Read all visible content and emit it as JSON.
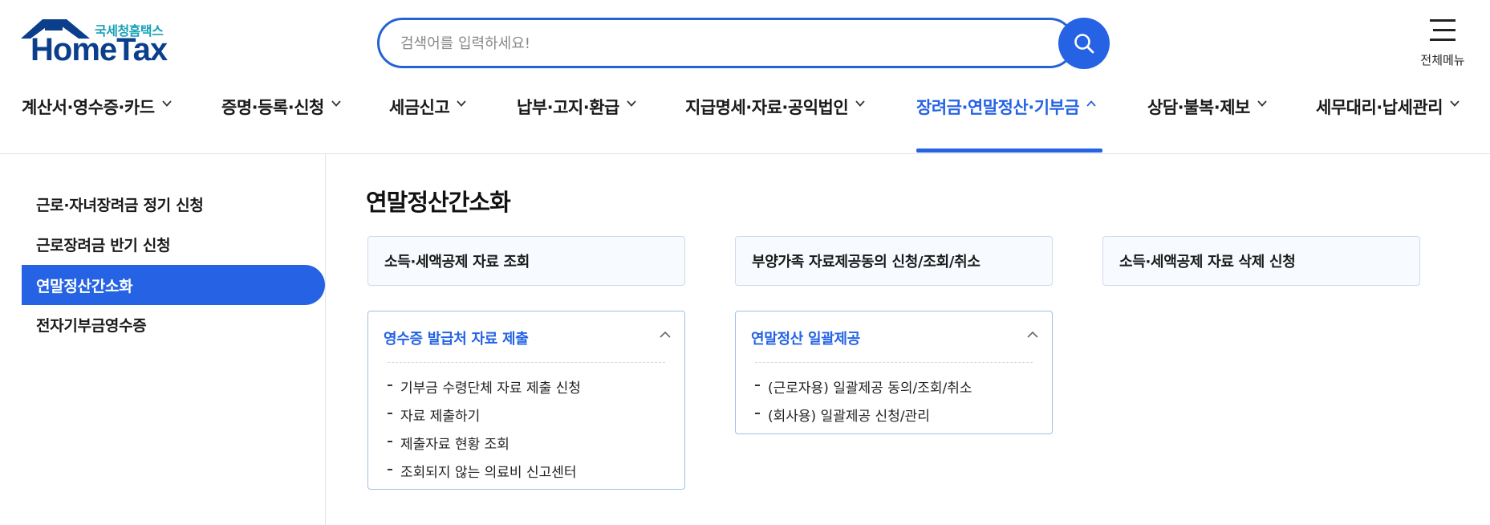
{
  "header": {
    "logo_subtitle": "국세청홈택스",
    "logo_title": "HomeTax",
    "search_placeholder": "검색어를 입력하세요!",
    "menu_label": "전체메뉴"
  },
  "nav": {
    "items": [
      {
        "label": "계산서·영수증·카드",
        "active": false
      },
      {
        "label": "증명·등록·신청",
        "active": false
      },
      {
        "label": "세금신고",
        "active": false
      },
      {
        "label": "납부·고지·환급",
        "active": false
      },
      {
        "label": "지급명세·자료·공익법인",
        "active": false
      },
      {
        "label": "장려금·연말정산·기부금",
        "active": true
      },
      {
        "label": "상담·불복·제보",
        "active": false
      },
      {
        "label": "세무대리·납세관리",
        "active": false
      }
    ]
  },
  "sidebar": {
    "items": [
      {
        "label": "근로·자녀장려금 정기 신청",
        "active": false
      },
      {
        "label": "근로장려금 반기 신청",
        "active": false
      },
      {
        "label": "연말정산간소화",
        "active": true
      },
      {
        "label": "전자기부금영수증",
        "active": false
      }
    ]
  },
  "main": {
    "title": "연말정산간소화",
    "cards": [
      {
        "label": "소득·세액공제 자료 조회"
      },
      {
        "label": "부양가족 자료제공동의 신청/조회/취소"
      },
      {
        "label": "소득·세액공제 자료 삭제 신청"
      }
    ],
    "panels": [
      {
        "title": "영수증 발급처 자료 제출",
        "links": [
          "기부금 수령단체 자료 제출 신청",
          "자료 제출하기",
          "제출자료 현황 조회",
          "조회되지 않는 의료비 신고센터"
        ]
      },
      {
        "title": "연말정산 일괄제공",
        "links": [
          "(근로자용) 일괄제공 동의/조회/취소",
          "(회사용) 일괄제공 신청/관리"
        ]
      }
    ]
  },
  "colors": {
    "accent": "#2563e4",
    "logo_navy": "#0b3f8c",
    "logo_teal": "#17a2b8"
  },
  "icons": {
    "search": "search-icon",
    "menu": "hamburger-menu-icon",
    "chevron_down": "chevron-down-icon",
    "chevron_up": "chevron-up-icon",
    "logo": "house-roof-icon"
  }
}
